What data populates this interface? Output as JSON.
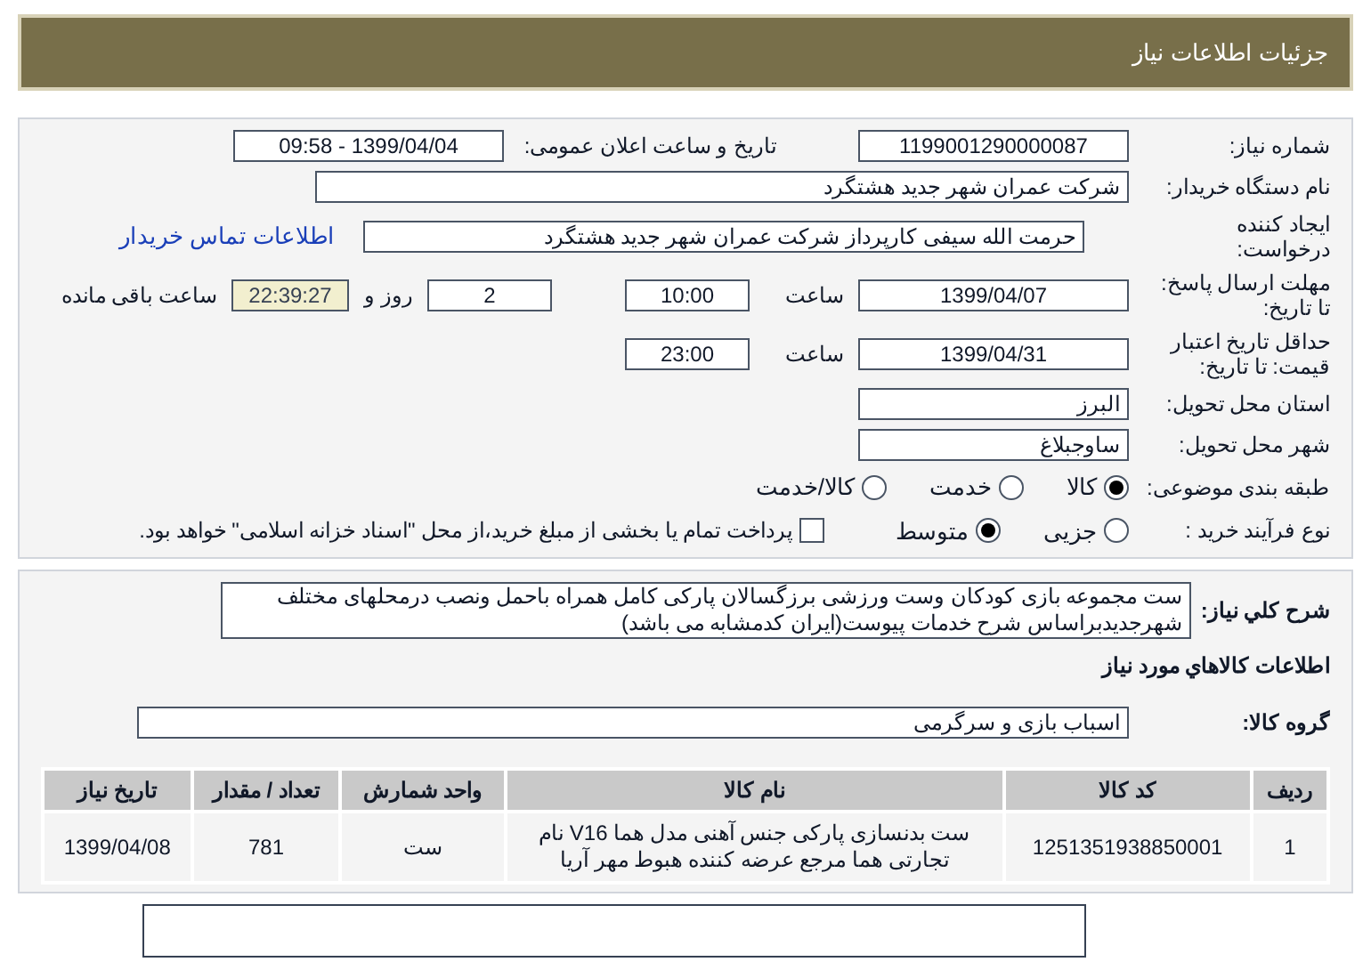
{
  "header": {
    "title": "جزئیات اطلاعات نیاز"
  },
  "need_number": {
    "label": "شماره نیاز:",
    "value": "1199001290000087"
  },
  "announce": {
    "label": "تاریخ و ساعت اعلان عمومی:",
    "value": "1399/04/04 - 09:58"
  },
  "buyer": {
    "label": "نام دستگاه خریدار:",
    "value": "شرکت عمران شهر جدید هشتگرد"
  },
  "creator": {
    "label": "ایجاد کننده درخواست:",
    "value": "حرمت الله  سیفی کارپرداز شرکت عمران شهر جدید هشتگرد",
    "link": "اطلاعات تماس خریدار"
  },
  "deadline": {
    "label": "مهلت ارسال پاسخ: تا تاریخ:",
    "date": "1399/04/07",
    "time_label": "ساعت",
    "time": "10:00",
    "days": "2",
    "days_label": "روز و",
    "remaining": "22:39:27",
    "remaining_label": "ساعت باقی مانده"
  },
  "validity": {
    "label": "حداقل تاریخ اعتبار قیمت: تا تاریخ:",
    "date": "1399/04/31",
    "time_label": "ساعت",
    "time": "23:00"
  },
  "province": {
    "label": "استان محل تحویل:",
    "value": "البرز"
  },
  "city": {
    "label": "شهر محل تحویل:",
    "value": "ساوجبلاغ"
  },
  "category": {
    "label": "طبقه بندی موضوعی:",
    "options": [
      {
        "label": "کالا",
        "selected": true
      },
      {
        "label": "خدمت",
        "selected": false
      },
      {
        "label": "کالا/خدمت",
        "selected": false
      }
    ]
  },
  "process": {
    "label": "نوع فرآیند خرید :",
    "options": [
      {
        "label": "جزیی",
        "selected": false
      },
      {
        "label": "متوسط",
        "selected": true
      }
    ],
    "payment": {
      "checked": false,
      "label": "پرداخت تمام یا بخشی از مبلغ خرید،از محل \"اسناد خزانه اسلامی\" خواهد بود."
    }
  },
  "description": {
    "label": "شرح کلي نياز:",
    "value": "ست مجموعه بازی کودکان وست ورزشی برزگسالان پارکی کامل همراه باحمل ونصب درمحلهای مختلف شهرجدیدبراساس شرح خدمات پیوست(ایران کدمشابه می باشد)"
  },
  "goods_title": "اطلاعات کالاهاي مورد نياز",
  "goods_group": {
    "label": "گروه کالا:",
    "value": "اسباب بازی و سرگرمی"
  },
  "table": {
    "columns": [
      "ردیف",
      "کد کالا",
      "نام کالا",
      "واحد شمارش",
      "تعداد / مقدار",
      "تاریخ نیاز"
    ],
    "rows": [
      [
        "1",
        "1251351938850001",
        "ست بدنسازی پارکی جنس آهنی مدل هما V16 نام تجارتی هما مرجع عرضه کننده هبوط مهر آریا",
        "ست",
        "781",
        "1399/04/08"
      ]
    ]
  }
}
